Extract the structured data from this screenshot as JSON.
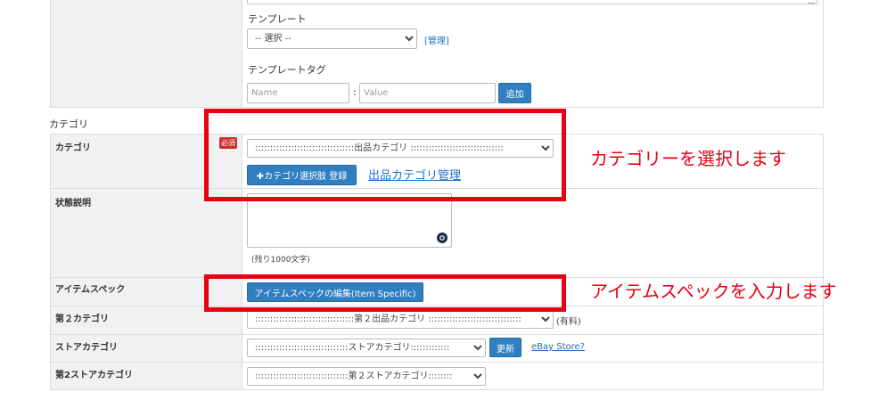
{
  "template_section": {
    "template_label": "テンプレート",
    "template_select_value": "-- 選択 --",
    "manage_link": "[管理]",
    "template_tag_label": "テンプレートタグ",
    "tag_name_placeholder": "Name",
    "tag_separator": ":",
    "tag_value_placeholder": "Value",
    "add_button": "追加"
  },
  "category_section": {
    "heading": "カテゴリ",
    "rows": {
      "category": {
        "label": "カテゴリ",
        "required_badge": "必須",
        "select_value": ":::::::::::::::::::::::::::::::::出品カテゴリ :::::::::::::::::::::::::::::::",
        "register_button": "✚カテゴリ選択肢 登録",
        "manage_link": "出品カテゴリ管理"
      },
      "condition": {
        "label": "状態説明",
        "remaining": "(残り1000文字)"
      },
      "item_specifics": {
        "label": "アイテムスペック",
        "edit_button": "アイテムスペックの編集(Item Specific)"
      },
      "second_category": {
        "label": "第２カテゴリ",
        "select_value": ":::::::::::::::::::::::::::::::::第２出品カテゴリ :::::::::::::::::::::::::::::::",
        "paid_note": "(有料)"
      },
      "store_category": {
        "label": "ストアカテゴリ",
        "select_value": ":::::::::::::::::::::::::::::::ストアカテゴリ:::::::::::::",
        "update_button": "更新",
        "ebay_store_link": "eBay Store?"
      },
      "second_store_category": {
        "label": "第2ストアカテゴリ",
        "select_value": ":::::::::::::::::::::::::::::::第２ストアカテゴリ::::::::"
      }
    }
  },
  "annotations": {
    "select_category": "カテゴリーを選択します",
    "enter_item_specifics": "アイテムスペックを入力します"
  },
  "colors": {
    "annotation_red": "#e60012",
    "button_blue": "#2f7fc1",
    "link_blue": "#1a6fc9",
    "badge_red": "#c9302c"
  }
}
